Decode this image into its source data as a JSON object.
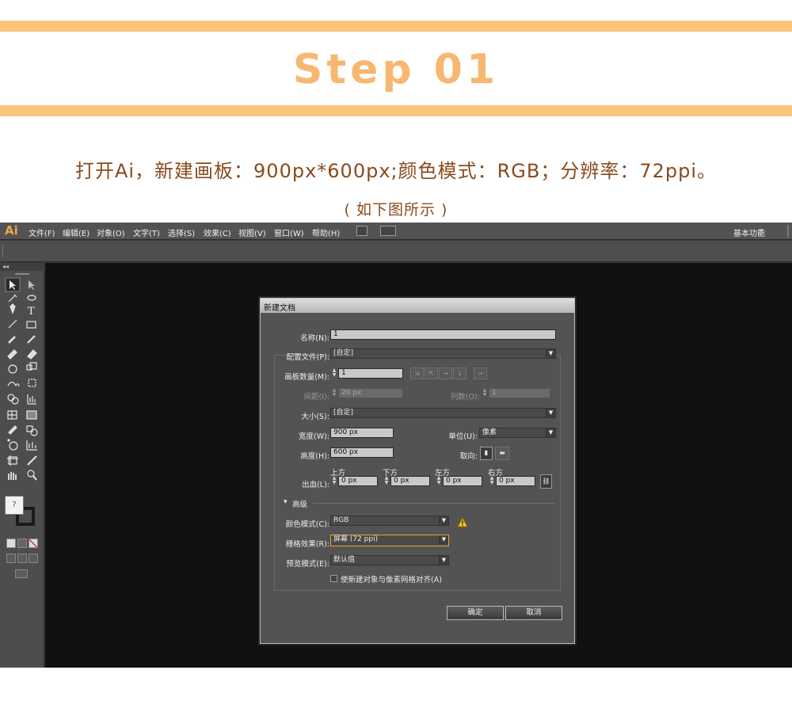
{
  "header": {
    "step_title": "Step 01",
    "instruction": "打开Ai，新建画板：900px*600px;颜色模式：RGB；分辨率：72ppi。",
    "caption": "( 如下图所示 )",
    "band_color": "#fbc57c",
    "title_color": "#f8b770"
  },
  "app": {
    "logo": "Ai",
    "menu": [
      "文件(F)",
      "编辑(E)",
      "对象(O)",
      "文字(T)",
      "选择(S)",
      "效果(C)",
      "视图(V)",
      "窗口(W)",
      "帮助(H)"
    ],
    "workspace": "基本功能",
    "workspace_arrow": "▾",
    "collapse_glyph": "◂◂",
    "tool_icons": [
      "selection-tool-icon",
      "direct-selection-tool-icon",
      "magic-wand-icon",
      "lasso-icon",
      "pen-tool-icon",
      "type-tool-icon",
      "line-tool-icon",
      "rectangle-tool-icon",
      "paintbrush-icon",
      "pencil-icon",
      "blob-brush-icon",
      "eraser-icon",
      "rotate-icon",
      "scale-icon",
      "warp-icon",
      "free-transform-icon",
      "shape-builder-icon",
      "graph-icon",
      "mesh-icon",
      "gradient-icon",
      "eyedropper-icon",
      "blend-icon",
      "symbol-sprayer-icon",
      "column-graph-icon",
      "artboard-icon",
      "slice-icon",
      "hand-icon",
      "zoom-icon"
    ],
    "fill_swatch_glyph": "?"
  },
  "dialog": {
    "title": "新建文档",
    "name_label": "名称(N):",
    "name_value": "1",
    "profile_label": "配置文件(P):",
    "profile_value": "[自定]",
    "artboards_label": "画板数量(M):",
    "artboards_value": "1",
    "artboard_arrange_icons": [
      "⇲",
      "⇱",
      "→",
      "↓",
      "→"
    ],
    "spacing_label": "间距(I):",
    "spacing_value": "20 px",
    "columns_label": "列数(O):",
    "columns_value": "1",
    "size_label": "大小(S):",
    "size_value": "[自定]",
    "width_label": "宽度(W):",
    "width_value": "900 px",
    "units_label": "单位(U):",
    "units_value": "像素",
    "height_label": "高度(H):",
    "height_value": "600 px",
    "orientation_label": "取向:",
    "orientation_icons": [
      "portrait-icon",
      "landscape-icon"
    ],
    "bleed_label": "出血(L):",
    "bleed": [
      {
        "label": "上方",
        "value": "0 px"
      },
      {
        "label": "下方",
        "value": "0 px"
      },
      {
        "label": "左方",
        "value": "0 px"
      },
      {
        "label": "右方",
        "value": "0 px"
      }
    ],
    "advanced_label": "高级",
    "advanced_arrow": "▾",
    "color_mode_label": "颜色模式(C):",
    "color_mode_value": "RGB",
    "raster_label": "栅格效果(R):",
    "raster_value": "屏幕 (72 ppi)",
    "preview_label": "预览模式(E):",
    "preview_value": "默认值",
    "align_pixel_label": "使新建对象与像素网格对齐(A)",
    "ok_label": "确定",
    "cancel_label": "取消"
  }
}
